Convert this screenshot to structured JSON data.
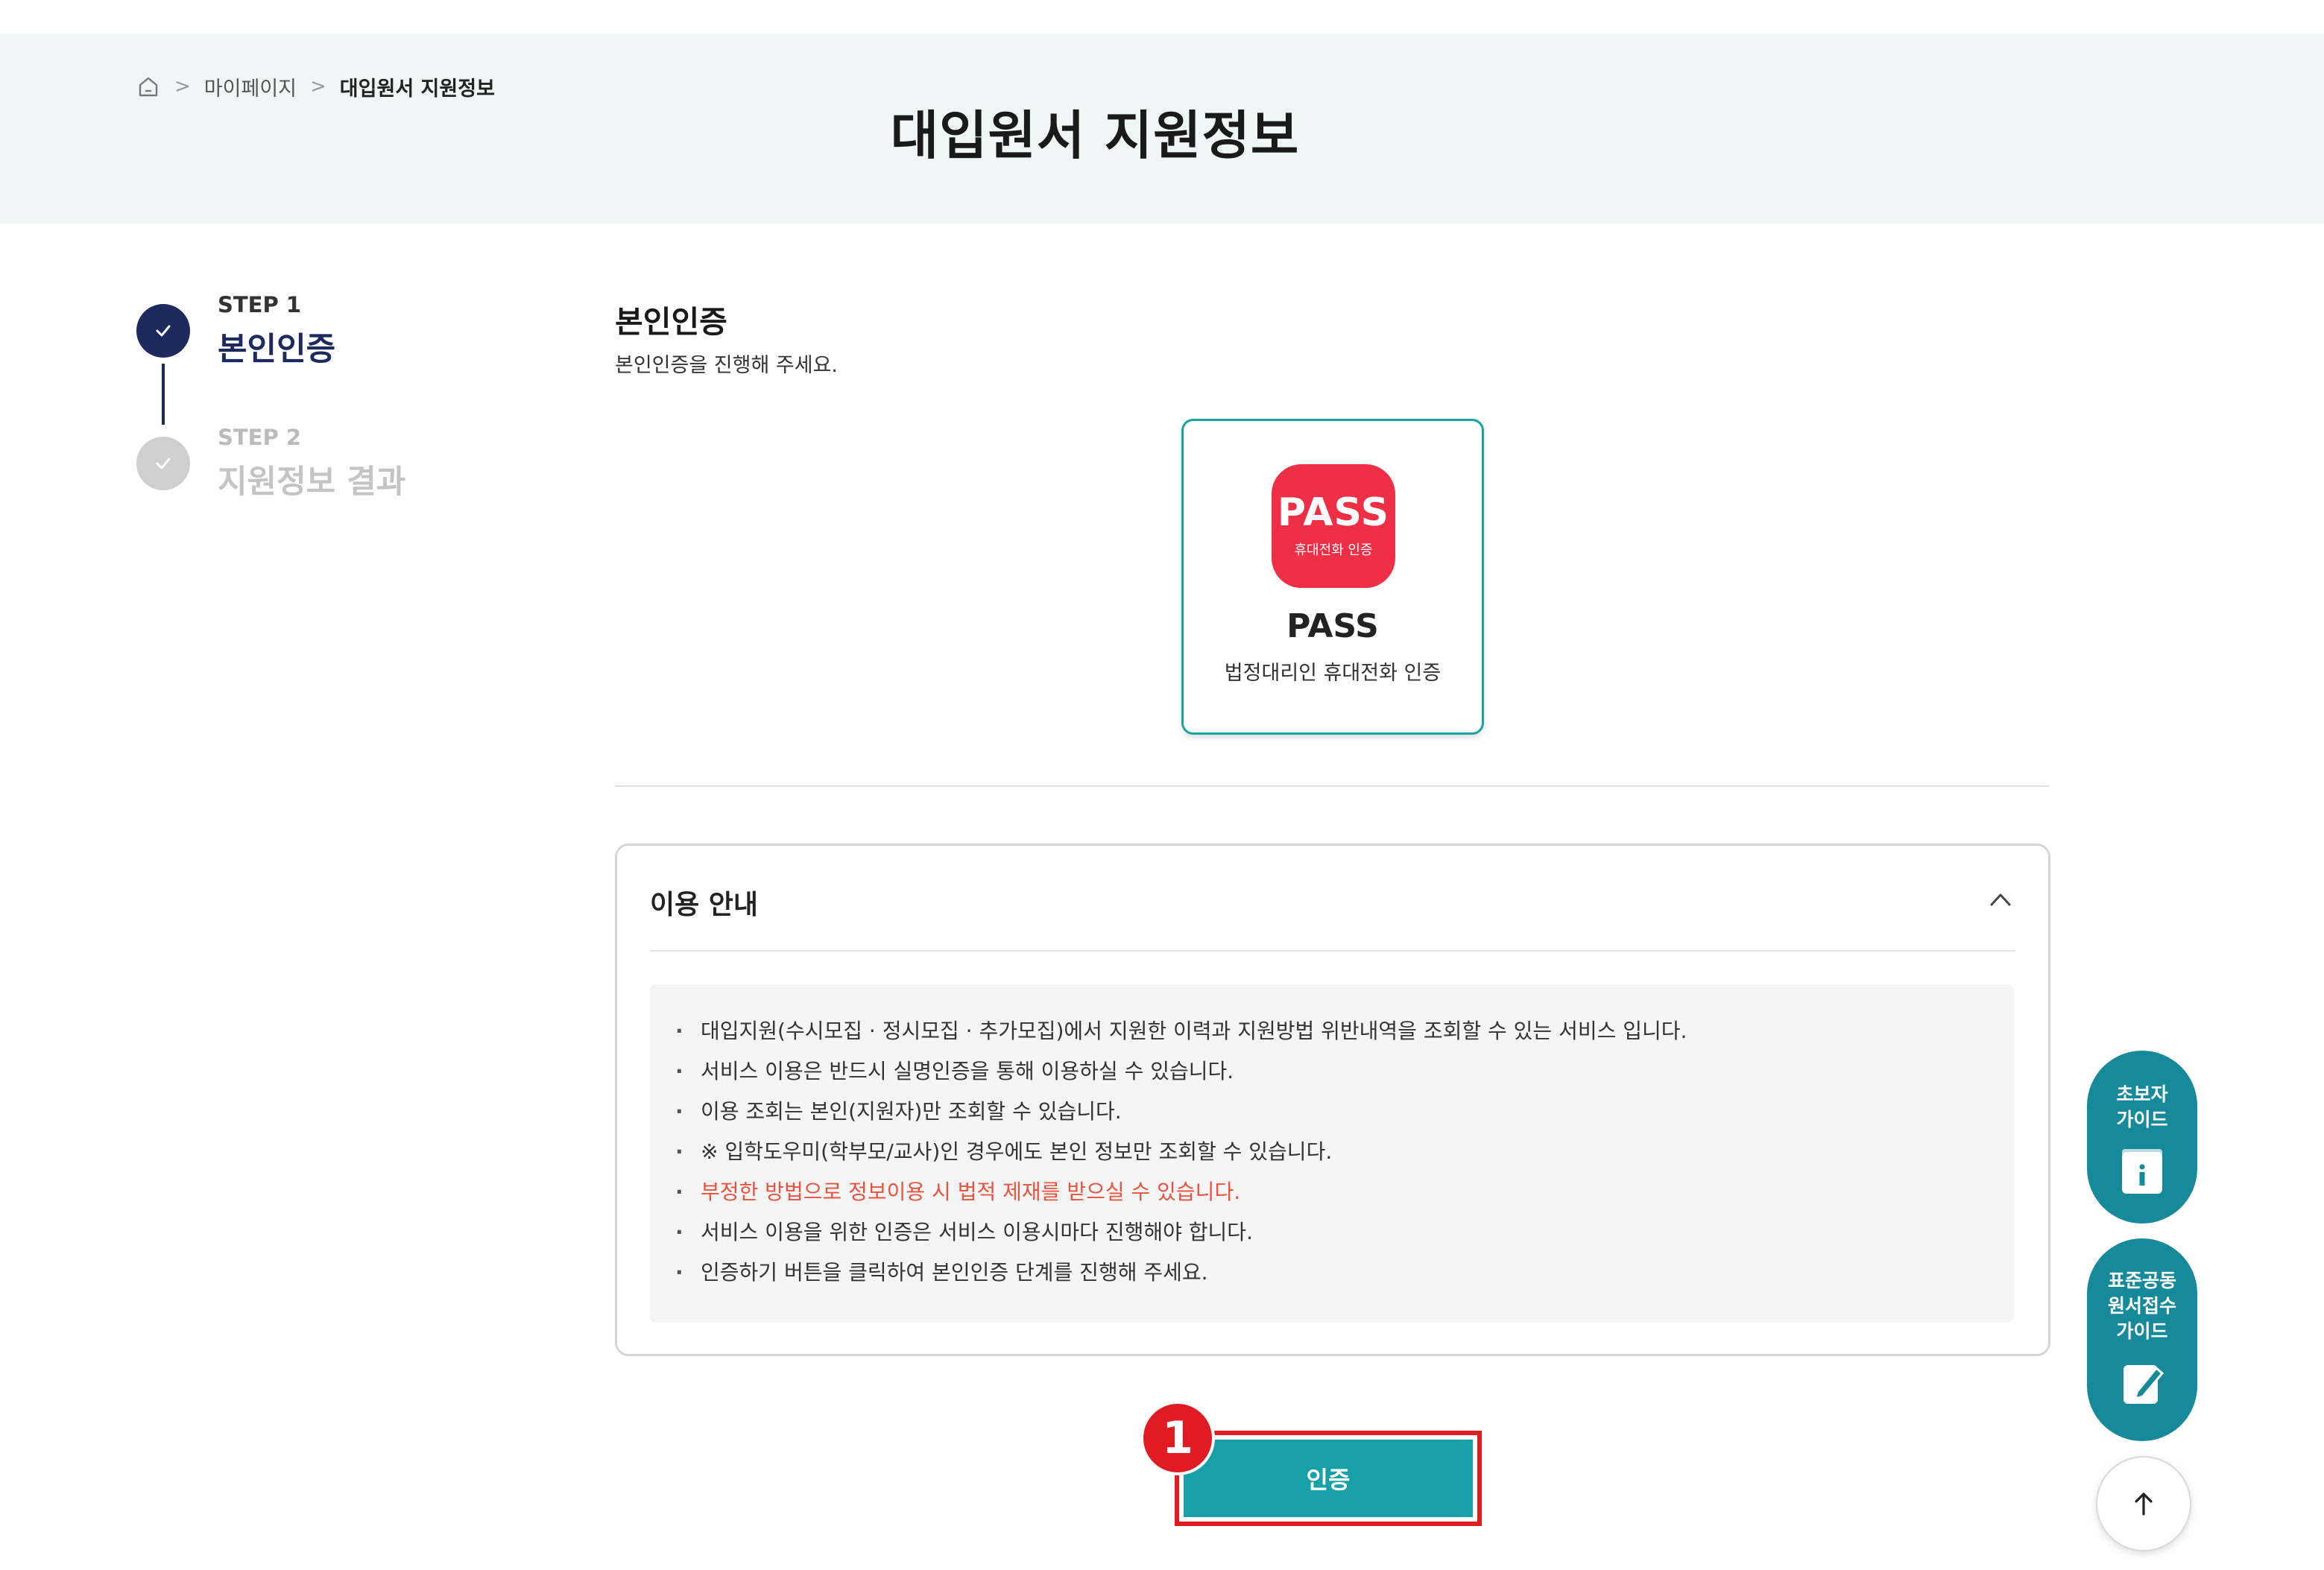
{
  "breadcrumb": {
    "home_icon": "home-icon",
    "items": [
      "마이페이지",
      "대입원서 지원정보"
    ],
    "separator": ">"
  },
  "page": {
    "title": "대입원서 지원정보"
  },
  "steps": [
    {
      "label": "STEP 1",
      "name": "본인인증",
      "status": "completed"
    },
    {
      "label": "STEP 2",
      "name": "지원정보 결과",
      "status": "pending"
    }
  ],
  "verification": {
    "title": "본인인증",
    "description": "본인인증을 진행해 주세요.",
    "method": {
      "logo_text": "PASS",
      "logo_sub": "휴대전화 인증",
      "name": "PASS",
      "description": "법정대리인 휴대전화 인증"
    }
  },
  "guide": {
    "title": "이용 안내",
    "toggle_icon": "chevron-up-icon",
    "items": [
      {
        "text": "대입지원(수시모집 · 정시모집 · 추가모집)에서 지원한 이력과 지원방법 위반내역을 조회할 수 있는 서비스 입니다."
      },
      {
        "text": "서비스 이용은 반드시 실명인증을 통해 이용하실 수 있습니다."
      },
      {
        "text": "이용 조회는 본인(지원자)만 조회할 수 있습니다."
      },
      {
        "text": "※ 입학도우미(학부모/교사)인 경우에도 본인 정보만 조회할 수 있습니다."
      },
      {
        "text": "부정한 방법으로 정보이용 시 법적 제재를 받으실 수 있습니다.",
        "highlight": true
      },
      {
        "text": "서비스 이용을 위한 인증은 서비스 이용시마다 진행해야 합니다."
      },
      {
        "text": "인증하기 버튼을 클릭하여 본인인증 단계를 진행해 주세요."
      }
    ]
  },
  "actions": {
    "auth_button": "인증",
    "annotation_badge": "1"
  },
  "floating": {
    "beginner_guide": "초보자\n가이드",
    "application_guide": "표준공동\n원서접수\n가이드",
    "top_icon": "arrow-up-icon"
  },
  "colors": {
    "header_bg": "#eef7f6",
    "step_active": "#1c2a5e",
    "accent": "#17a1a6",
    "pass_red": "#ef2f46",
    "warning": "#e8523f",
    "annotation": "#e01b22"
  }
}
